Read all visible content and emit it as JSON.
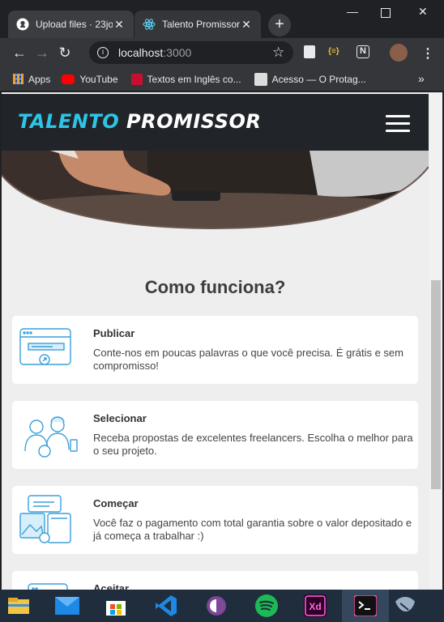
{
  "browser": {
    "tabs": [
      {
        "label": "Upload files · 23jo",
        "icon": "github-icon",
        "active": false
      },
      {
        "label": "Talento Promissor",
        "icon": "react-icon",
        "active": true
      }
    ],
    "new_tab": "+",
    "url_host": "localhost",
    "url_port": ":3000",
    "bookmarks": [
      {
        "label": "Apps",
        "icon": "apps-grid-icon"
      },
      {
        "label": "YouTube",
        "icon": "youtube-icon"
      },
      {
        "label": "Textos em Inglês co...",
        "icon": "aig-icon"
      },
      {
        "label": "Acesso — O Protag...",
        "icon": "puzzle-icon"
      }
    ],
    "more_bookmarks": "»"
  },
  "site": {
    "logo_part1": "TALENTO",
    "logo_part2": "PROMISSOR",
    "section_title": "Como funciona?",
    "steps": [
      {
        "title": "Publicar",
        "desc": "Conte-nos em poucas palavras o que você precisa. É grátis e sem compromisso!",
        "icon": "publish-browser-icon"
      },
      {
        "title": "Selecionar",
        "desc": "Receba propostas de excelentes freelancers. Escolha o melhor para o seu projeto.",
        "icon": "select-people-icon"
      },
      {
        "title": "Começar",
        "desc": "Você faz o pagamento com total garantia sobre o valor depositado e já começa a trabalhar :)",
        "icon": "start-devices-icon"
      },
      {
        "title": "Aceitar",
        "desc": "",
        "icon": "accept-icon"
      }
    ]
  },
  "colors": {
    "accent": "#2ec4e6",
    "navbar": "#212529",
    "page_bg": "#eeeeee"
  },
  "taskbar": [
    "file-explorer-icon",
    "mail-icon",
    "store-icon",
    "vscode-icon",
    "tor-icon",
    "spotify-icon",
    "adobe-xd-icon",
    "terminal-icon",
    "app-icon"
  ]
}
